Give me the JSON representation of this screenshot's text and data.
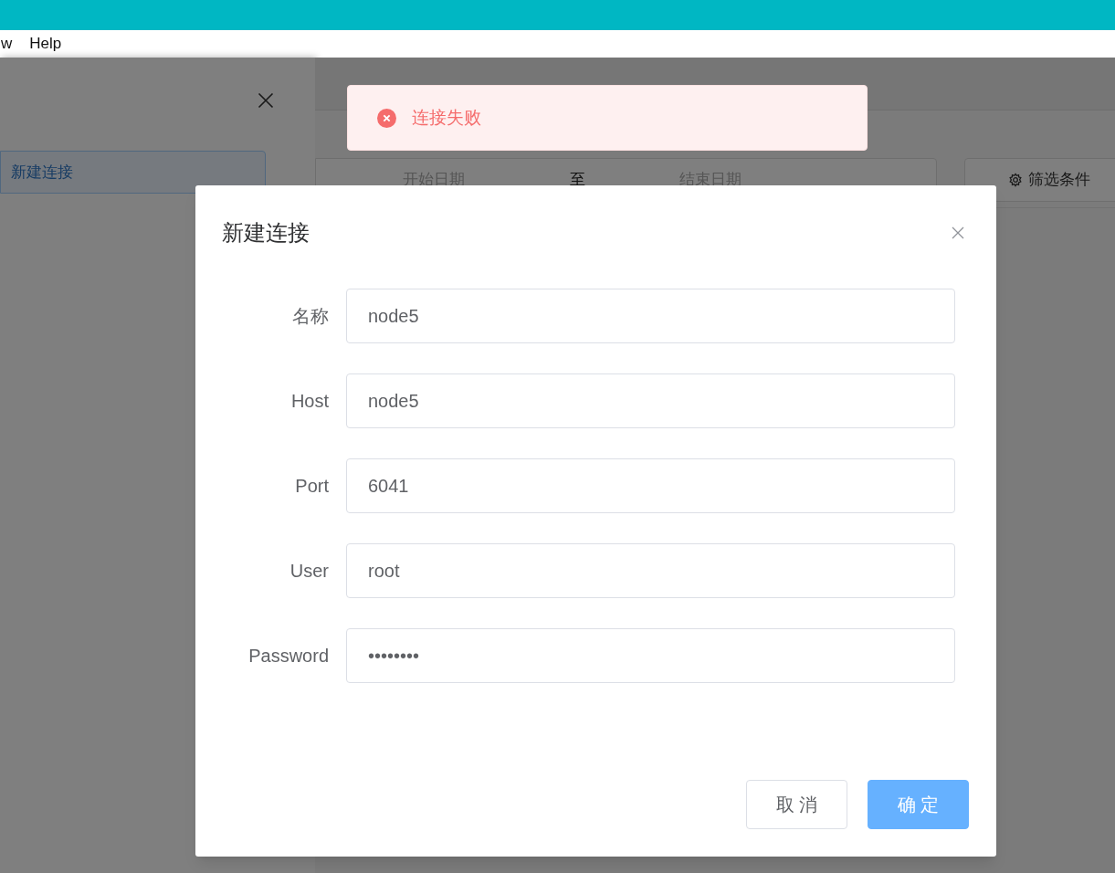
{
  "menu_bar": {
    "items": [
      "w",
      "Help"
    ]
  },
  "drawer": {
    "items": [
      {
        "label": "新建连接",
        "selected": true
      }
    ]
  },
  "toolbar": {
    "date_start_placeholder": "开始日期",
    "separator": "至",
    "date_end_placeholder": "结束日期",
    "filter_button": "筛选条件"
  },
  "message": {
    "kind": "error",
    "text": "连接失败"
  },
  "dialog": {
    "title": "新建连接",
    "fields": [
      {
        "label": "名称",
        "value": "node5"
      },
      {
        "label": "Host",
        "value": "node5"
      },
      {
        "label": "Port",
        "value": "6041"
      },
      {
        "label": "User",
        "value": "root"
      },
      {
        "label": "Password",
        "value": "••••••••"
      }
    ],
    "buttons": [
      {
        "label": "取 消",
        "kind": "default"
      },
      {
        "label": "确 定",
        "kind": "primary"
      }
    ]
  }
}
